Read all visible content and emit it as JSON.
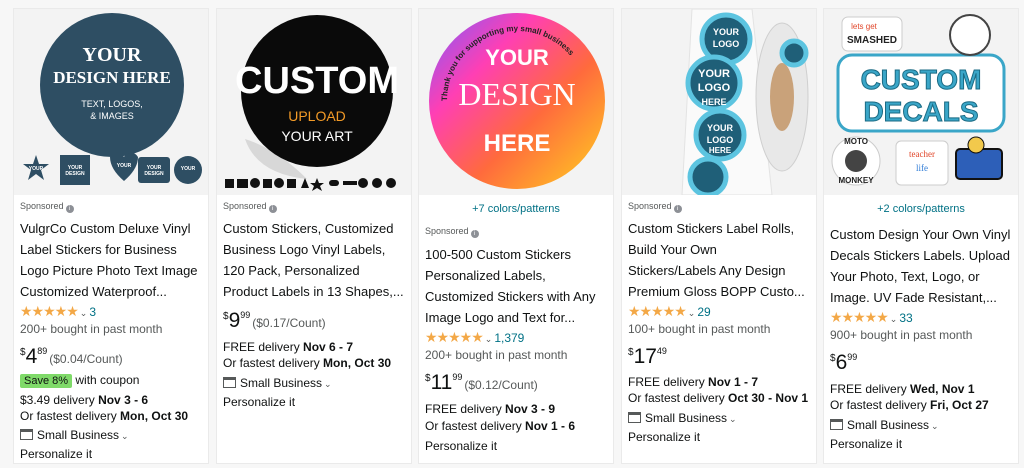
{
  "products": [
    {
      "sponsored": "Sponsored",
      "title_lines": [
        "VulgrCo Custom Deluxe Vinyl",
        "Label Stickers for Business",
        "Logo Picture Photo Text Image",
        "Customized Waterproof..."
      ],
      "stars": "★★★★★",
      "rating_count": "3",
      "bought": "200+ bought in past month",
      "price_symbol": "$",
      "price_whole": "4",
      "price_fraction": "89",
      "unit_price": "($0.04/Count)",
      "coupon_badge": "Save 8%",
      "coupon_text": "with coupon",
      "delivery_prefix": "$3.49 delivery",
      "delivery_date": "Nov 3 - 6",
      "fastest_prefix": "Or fastest delivery",
      "fastest_date": "Mon, Oct 30",
      "small_business": "Small Business",
      "personalize": "Personalize it",
      "image_texts": [
        "YOUR",
        "DESIGN HERE",
        "TEXT, LOGOS,",
        "& IMAGES"
      ],
      "mini_text": [
        "YOUR DESIGN HERE"
      ]
    },
    {
      "sponsored": "Sponsored",
      "title_lines": [
        "Custom Stickers, Customized",
        "Business Logo Vinyl Labels,",
        "120 Pack, Personalized",
        "Product Labels in 13 Shapes,..."
      ],
      "price_symbol": "$",
      "price_whole": "9",
      "price_fraction": "99",
      "unit_price": "($0.17/Count)",
      "delivery_prefix": "FREE delivery",
      "delivery_date": "Nov 6 - 7",
      "fastest_prefix": "Or fastest delivery",
      "fastest_date": "Mon, Oct 30",
      "small_business": "Small Business",
      "personalize": "Personalize it",
      "image_texts": [
        "CUSTOM",
        "UPLOAD",
        "YOUR ART"
      ]
    },
    {
      "colors_link": "+7 colors/patterns",
      "sponsored": "Sponsored",
      "title_lines": [
        "100-500 Custom Stickers",
        "Personalized Labels,",
        "Customized Stickers with Any",
        "Image Logo and Text for..."
      ],
      "stars": "★★★★★",
      "rating_value": 4.5,
      "rating_count": "1,379",
      "bought": "200+ bought in past month",
      "price_symbol": "$",
      "price_whole": "11",
      "price_fraction": "99",
      "unit_price": "($0.12/Count)",
      "delivery_prefix": "FREE delivery",
      "delivery_date": "Nov 3 - 9",
      "fastest_prefix": "Or fastest delivery",
      "fastest_date": "Nov 1 - 6",
      "personalize": "Personalize it",
      "image_texts": [
        "Thank you for supporting my small business",
        "YOUR",
        "DESIGN",
        "HERE"
      ]
    },
    {
      "sponsored": "Sponsored",
      "title_lines": [
        "Custom Stickers Label Rolls,",
        "Build Your Own",
        "Stickers/Labels Any Design",
        "Premium Gloss BOPP Custo..."
      ],
      "stars": "★★★★★",
      "rating_value": 4.5,
      "rating_count": "29",
      "bought": "100+ bought in past month",
      "price_symbol": "$",
      "price_whole": "17",
      "price_fraction": "49",
      "delivery_prefix": "FREE delivery",
      "delivery_date": "Nov 1 - 7",
      "fastest_prefix": "Or fastest delivery",
      "fastest_date": "Oct 30 - Nov 1",
      "small_business": "Small Business",
      "personalize": "Personalize it",
      "image_texts": [
        "YOUR",
        "LOGO",
        "HERE"
      ]
    },
    {
      "colors_link": "+2 colors/patterns",
      "title_lines": [
        "Custom Design Your Own Vinyl",
        "Decals Stickers Labels. Upload",
        "Your Photo, Text, Logo, or",
        "Image. UV Fade Resistant,..."
      ],
      "stars": "★★★★★",
      "rating_value": 4.5,
      "rating_count": "33",
      "bought": "900+ bought in past month",
      "price_symbol": "$",
      "price_whole": "6",
      "price_fraction": "99",
      "delivery_prefix": "FREE delivery",
      "delivery_date": "Wed, Nov 1",
      "fastest_prefix": "Or fastest delivery",
      "fastest_date": "Fri, Oct 27",
      "small_business": "Small Business",
      "personalize": "Personalize it",
      "image_texts": [
        "CUSTOM",
        "DECALS",
        "lets get",
        "SMASHED",
        "MOTO",
        "MONKEY",
        "teacher",
        "life"
      ]
    }
  ],
  "colors": {
    "link": "#007185",
    "star": "#f3a847",
    "badge": "#7fda69",
    "muted": "#565959"
  }
}
